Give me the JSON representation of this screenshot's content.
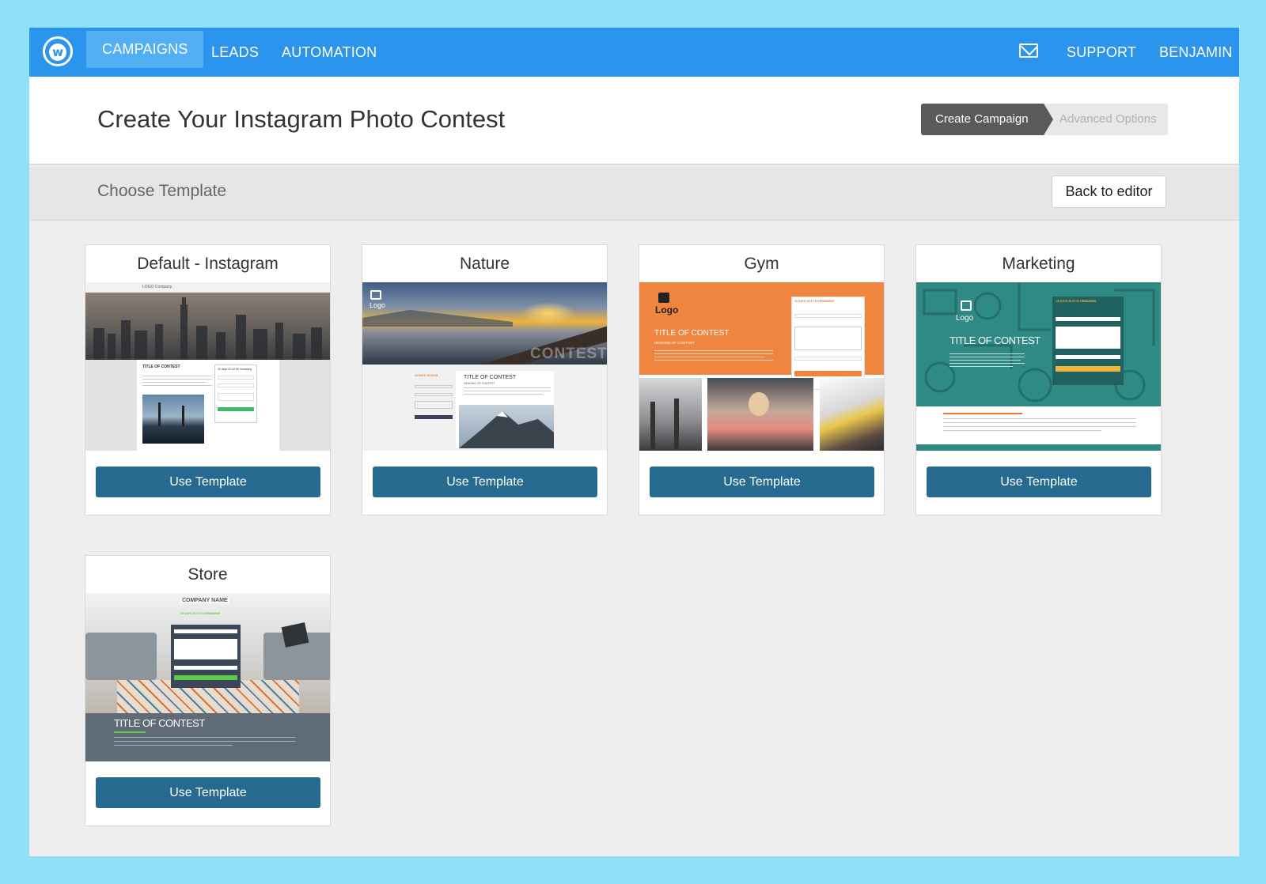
{
  "nav": {
    "items": [
      "CAMPAIGNS",
      "LEADS",
      "AUTOMATION"
    ],
    "support": "SUPPORT",
    "user": "BENJAMIN"
  },
  "header": {
    "title": "Create Your Instagram Photo Contest",
    "steps": [
      "Create Campaign",
      "Advanced Options"
    ]
  },
  "subheader": {
    "title": "Choose Template",
    "back_label": "Back to editor"
  },
  "templates": [
    {
      "name": "Default - Instagram",
      "button": "Use Template"
    },
    {
      "name": "Nature",
      "button": "Use Template"
    },
    {
      "name": "Gym",
      "button": "Use Template"
    },
    {
      "name": "Marketing",
      "button": "Use Template"
    },
    {
      "name": "Store",
      "button": "Use Template"
    }
  ],
  "previews": {
    "default": {
      "logo": "LOGO Company",
      "title": "TITLE OF CONTEST",
      "timer": "20 days 22:42:59 remaining"
    },
    "nature": {
      "logo": "Logo",
      "watermark": "CONTEST",
      "title": "TITLE OF CONTEST",
      "heading": "HEADING OF CONTEST",
      "timer": "20 DAYS 22:34:06"
    },
    "gym": {
      "logo": "Logo",
      "title": "TITLE OF CONTEST",
      "heading": "HEADING OF CONTEST",
      "timer": "20 DAYS 23:37:34 REMAINING"
    },
    "marketing": {
      "logo": "Logo",
      "title": "TITLE OF CONTEST",
      "timer": "20 DAYS 23:37:03 REMAINING"
    },
    "store": {
      "company": "COMPANY NAME",
      "title": "TITLE OF CONTEST",
      "timer": "20 DAYS 23:47:03 REMAINING"
    }
  },
  "colors": {
    "nav_bg": "#2b95ed",
    "nav_active": "#52aff4",
    "button_bg": "#266b8f",
    "page_bg": "#8fe0f8",
    "gym_orange": "#f0853f",
    "marketing_teal": "#2f8a86"
  }
}
